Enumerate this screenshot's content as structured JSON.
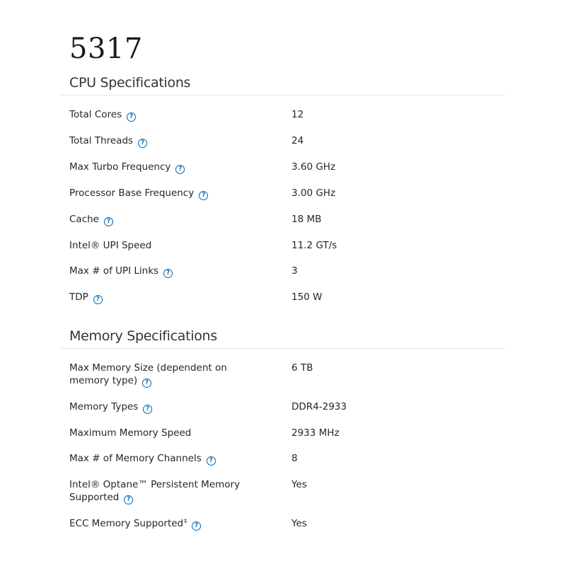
{
  "product": {
    "title": "5317"
  },
  "colors": {
    "help_icon": "#0068b5",
    "divider": "#e6e6e6",
    "text": "#262626"
  },
  "cpu_specs": {
    "heading": "CPU Specifications",
    "rows": [
      {
        "label": "Total Cores",
        "value": "12",
        "help_icon": "question-circle-icon"
      },
      {
        "label": "Total Threads",
        "value": "24",
        "help_icon": "question-circle-icon"
      },
      {
        "label": "Max Turbo Frequency",
        "value": "3.60 GHz",
        "help_icon": "question-circle-icon"
      },
      {
        "label": "Processor Base Frequency",
        "value": "3.00 GHz",
        "help_icon": "question-circle-icon"
      },
      {
        "label": "Cache",
        "value": "18 MB",
        "help_icon": "question-circle-icon"
      },
      {
        "label": "Intel® UPI Speed",
        "value": "11.2 GT/s"
      },
      {
        "label": "Max # of UPI Links",
        "value": "3",
        "help_icon": "question-circle-icon"
      },
      {
        "label": "TDP",
        "value": "150 W",
        "help_icon": "question-circle-icon"
      }
    ]
  },
  "memory_specs": {
    "heading": "Memory Specifications",
    "rows": [
      {
        "label": "Max Memory Size (dependent on memory type)",
        "value": "6 TB",
        "help_icon": "question-circle-icon"
      },
      {
        "label": "Memory Types",
        "value": "DDR4-2933",
        "help_icon": "question-circle-icon"
      },
      {
        "label": "Maximum Memory Speed",
        "value": "2933 MHz"
      },
      {
        "label": "Max # of Memory Channels",
        "value": "8",
        "help_icon": "question-circle-icon"
      },
      {
        "label": "Intel® Optane™ Persistent Memory Supported",
        "value": "Yes",
        "help_icon": "question-circle-icon"
      },
      {
        "label": "ECC Memory Supported",
        "footnote": "‡",
        "value": "Yes",
        "help_icon": "question-circle-icon"
      }
    ]
  },
  "help_glyph": "?"
}
